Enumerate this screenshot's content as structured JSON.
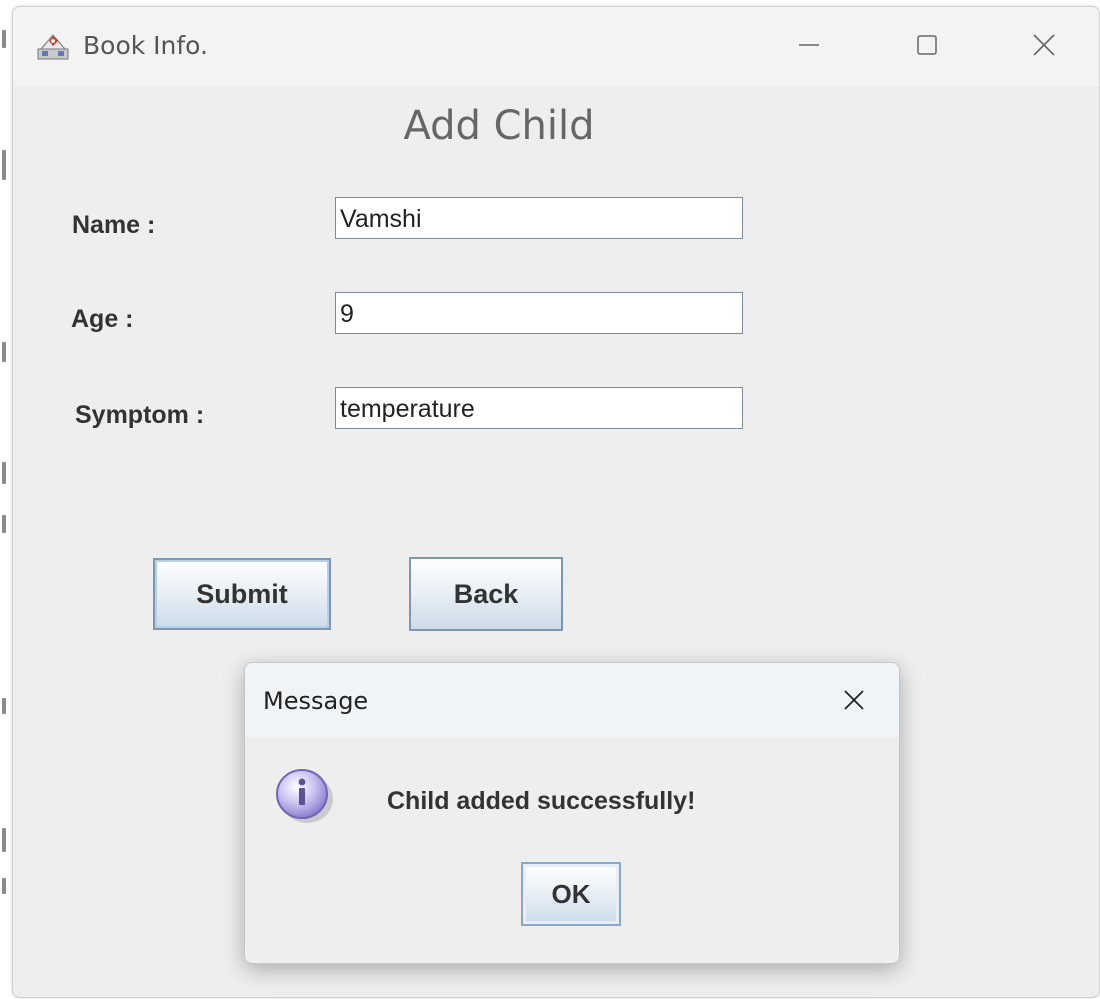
{
  "window": {
    "title": "Book Info.",
    "controls": {
      "minimize": "minimize-icon",
      "maximize": "maximize-icon",
      "close": "close-icon"
    }
  },
  "form": {
    "title": "Add Child",
    "fields": [
      {
        "label": "Name :",
        "value": "Vamshi"
      },
      {
        "label": "Age :",
        "value": "9"
      },
      {
        "label": "Symptom :",
        "value": "temperature"
      }
    ],
    "buttons": {
      "submit": "Submit",
      "back": "Back"
    }
  },
  "dialog": {
    "title": "Message",
    "icon": "info-icon",
    "message": "Child added successfully!",
    "ok_label": "OK"
  },
  "colors": {
    "window_bg": "#eeeeee",
    "button_border": "#7a98b6",
    "info_icon": "#9a8fd6"
  }
}
